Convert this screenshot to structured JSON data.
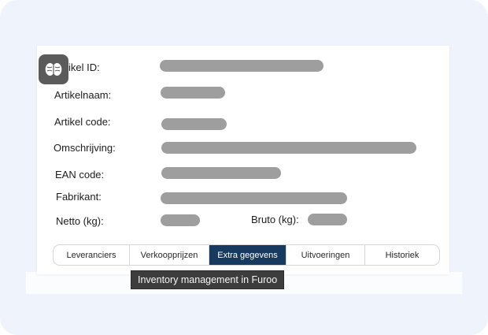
{
  "form": {
    "artikel_id": "Artikel ID:",
    "artikel_id_visible": "ikel ID:",
    "artikelnaam": "Artikelnaam:",
    "artikel_code": "Artikel code:",
    "omschrijving": "Omschrijving:",
    "ean_code": "EAN code:",
    "fabrikant": "Fabrikant:",
    "netto": "Netto (kg):",
    "bruto": "Bruto (kg):"
  },
  "tabs": [
    {
      "label": "Leveranciers",
      "active": false
    },
    {
      "label": "Verkoopprijzen",
      "active": false
    },
    {
      "label": "Extra gegevens",
      "active": true
    },
    {
      "label": "Uitvoeringen",
      "active": false
    },
    {
      "label": "Historiek",
      "active": false
    }
  ],
  "tooltip": "Inventory management in Furoo",
  "logo_icon": "brain-icon",
  "colors": {
    "active_tab": "#173a5e",
    "placeholder_bar": "#9e9e9e",
    "tooltip_bg": "#3d3d3d"
  }
}
